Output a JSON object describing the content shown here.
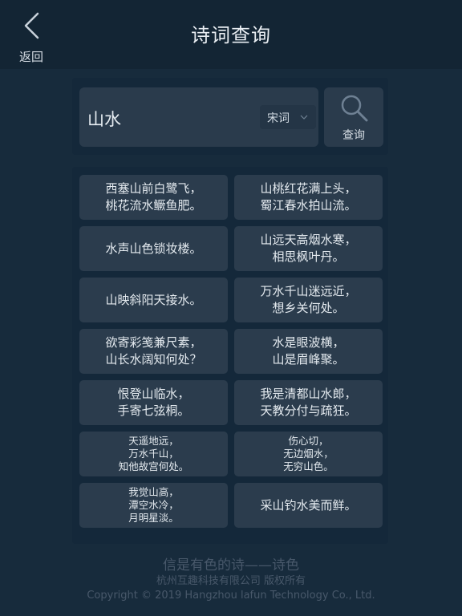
{
  "header": {
    "back_label": "返回",
    "title": "诗词查询"
  },
  "search": {
    "query": "山水",
    "dynasty_selected": "宋词",
    "button_label": "查询"
  },
  "results": [
    {
      "text": "西塞山前白鹭飞，\n桃花流水鳜鱼肥。",
      "size": "l"
    },
    {
      "text": "山桃红花满上头，\n蜀江春水拍山流。",
      "size": "l"
    },
    {
      "text": "水声山色锁妆楼。",
      "size": "l"
    },
    {
      "text": "山远天高烟水寒，\n相思枫叶丹。",
      "size": "l"
    },
    {
      "text": "山映斜阳天接水。",
      "size": "l"
    },
    {
      "text": "万水千山迷远近，\n想乡关何处。",
      "size": "l"
    },
    {
      "text": "欲寄彩笺兼尺素，\n山长水阔知何处？",
      "size": "l"
    },
    {
      "text": "水是眼波横，\n山是眉峰聚。",
      "size": "l"
    },
    {
      "text": "恨登山临水，\n手寄七弦桐。",
      "size": "l"
    },
    {
      "text": "我是清都山水郎，\n天教分付与疏狂。",
      "size": "l"
    },
    {
      "text": "天遥地远，\n万水千山，\n知他故宫何处。",
      "size": "s"
    },
    {
      "text": "伤心切，\n无边烟水，\n无穷山色。",
      "size": "s"
    },
    {
      "text": "我觉山高，\n潭空水冷，\n月明星淡。",
      "size": "s"
    },
    {
      "text": "采山钓水美而鲜。",
      "size": "l"
    }
  ],
  "footer": {
    "slogan": "信是有色的诗——诗色",
    "company": "杭州互趣科技有限公司 版权所有",
    "copyright": "Copyright © 2019 Hangzhou lafun Technology Co., Ltd."
  },
  "icons": {
    "back": "chevron-left-icon",
    "dropdown": "chevron-down-icon",
    "search": "search-icon"
  },
  "colors": {
    "background": "#172b3c",
    "header": "#132534",
    "panel": "#14283a",
    "card": "#2b3c4d"
  }
}
